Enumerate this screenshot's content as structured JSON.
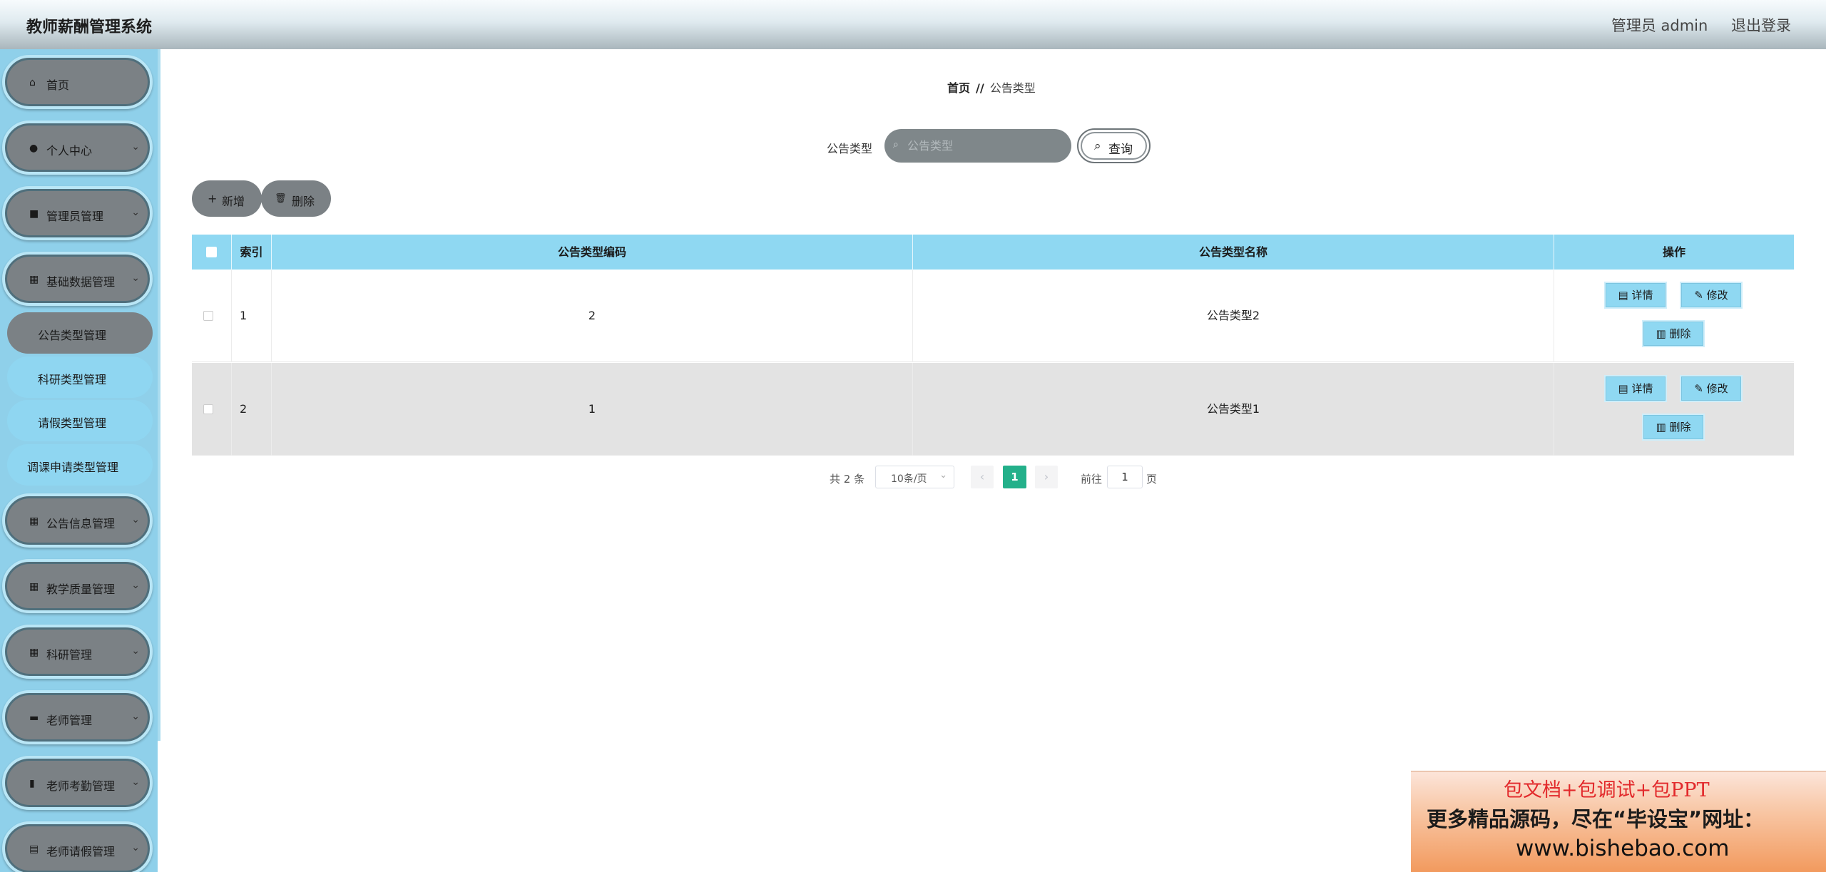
{
  "header": {
    "title": "教师薪酬管理系统",
    "user": "管理员 admin",
    "logout": "退出登录"
  },
  "sidebar": {
    "items": [
      {
        "label": "首页",
        "icon": "home-icon",
        "glyph": "⌂",
        "chevron": ""
      },
      {
        "label": "个人中心",
        "icon": "user-icon",
        "glyph": "●",
        "chevron": "⌄"
      },
      {
        "label": "管理员管理",
        "icon": "chat-icon",
        "glyph": "■",
        "chevron": "⌄"
      },
      {
        "label": "基础数据管理",
        "icon": "grid-icon",
        "glyph": "▦",
        "chevron": "⌄"
      },
      {
        "label": "公告信息管理",
        "icon": "grid-icon",
        "glyph": "▦",
        "chevron": "⌄"
      },
      {
        "label": "教学质量管理",
        "icon": "grid-icon",
        "glyph": "▦",
        "chevron": "⌄"
      },
      {
        "label": "科研管理",
        "icon": "grid-icon",
        "glyph": "▦",
        "chevron": "⌄"
      },
      {
        "label": "老师管理",
        "icon": "briefcase-icon",
        "glyph": "▬",
        "chevron": "⌄"
      },
      {
        "label": "老师考勤管理",
        "icon": "bar-chart-icon",
        "glyph": "▮",
        "chevron": "⌄"
      },
      {
        "label": "老师请假管理",
        "icon": "clipboard-icon",
        "glyph": "▤",
        "chevron": "⌄"
      }
    ],
    "subitems": [
      {
        "label": "公告类型管理",
        "active": true
      },
      {
        "label": "科研类型管理",
        "active": false
      },
      {
        "label": "请假类型管理",
        "active": false
      },
      {
        "label": "调课申请类型管理",
        "active": false
      }
    ]
  },
  "breadcrumb": {
    "home": "首页",
    "separator": "//",
    "current": "公告类型"
  },
  "search": {
    "label": "公告类型",
    "placeholder": "公告类型",
    "value": "",
    "search_icon": "⌕",
    "button_icon": "⌕",
    "button": "查询"
  },
  "toolbar": {
    "add_icon": "+",
    "add": "新增",
    "delete_icon": "🗑",
    "delete": "删除"
  },
  "table": {
    "columns": [
      "",
      "索引",
      "公告类型编码",
      "公告类型名称",
      "操作"
    ],
    "rows": [
      {
        "index": "1",
        "code": "2",
        "name": "公告类型2"
      },
      {
        "index": "2",
        "code": "1",
        "name": "公告类型1"
      }
    ],
    "actions": {
      "detail": "详情",
      "edit": "修改",
      "delete": "删除"
    }
  },
  "pagination": {
    "total": "共 2 条",
    "page_size": "10条/页",
    "prev": "‹",
    "next": "›",
    "current_page": "1",
    "goto_label": "前往",
    "goto_value": "1",
    "page_unit": "页"
  },
  "watermark": {
    "line1": "包文档+包调试+包PPT",
    "line2": "更多精品源码，尽在“毕设宝”网址：",
    "line3": "www.bishebao.com"
  },
  "colors": {
    "sidebar_bg": "#8fd0ea",
    "menu_item_bg": "#7b8185",
    "table_header_bg": "#8fd8f2",
    "page_active": "#23b08a"
  }
}
